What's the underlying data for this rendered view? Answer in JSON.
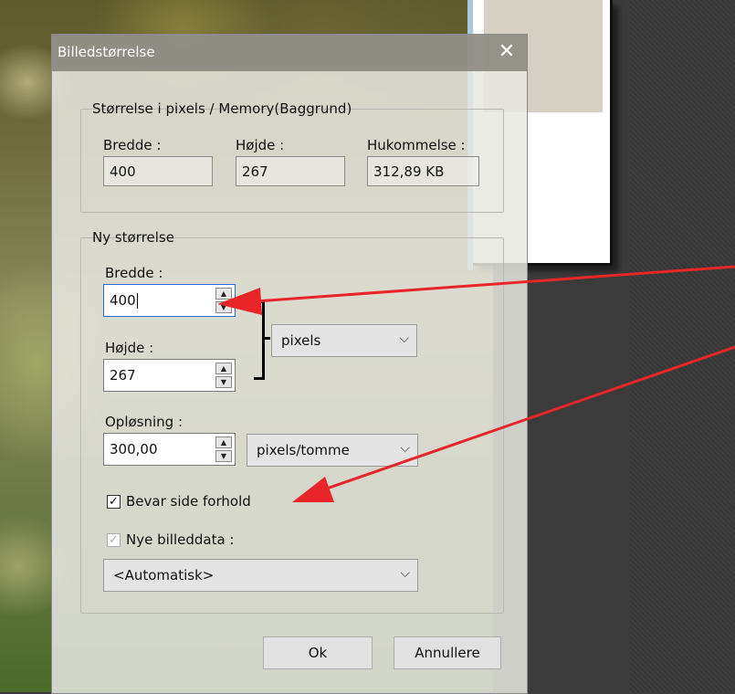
{
  "dialog": {
    "title": "Billedstørrelse",
    "close_glyph": "✕"
  },
  "current_size": {
    "legend": "Størrelse i pixels / Memory(Baggrund)",
    "width_label": "Bredde :",
    "width_value": "400",
    "height_label": "Højde :",
    "height_value": "267",
    "memory_label": "Hukommelse :",
    "memory_value": "312,89 KB"
  },
  "new_size": {
    "legend": "Ny størrelse",
    "width_label": "Bredde :",
    "width_value": "400",
    "height_label": "Højde :",
    "height_value": "267",
    "unit_selected": "pixels",
    "resolution_label": "Opløsning :",
    "resolution_value": "300,00",
    "resolution_unit_selected": "pixels/tomme",
    "keep_ratio_label": "Bevar side forhold",
    "keep_ratio_checked": true,
    "new_data_label": "Nye billeddata :",
    "new_data_checked": true,
    "new_data_selected": "<Automatisk>"
  },
  "buttons": {
    "ok": "Ok",
    "cancel": "Annullere"
  },
  "annotation_color": "#e8262a"
}
